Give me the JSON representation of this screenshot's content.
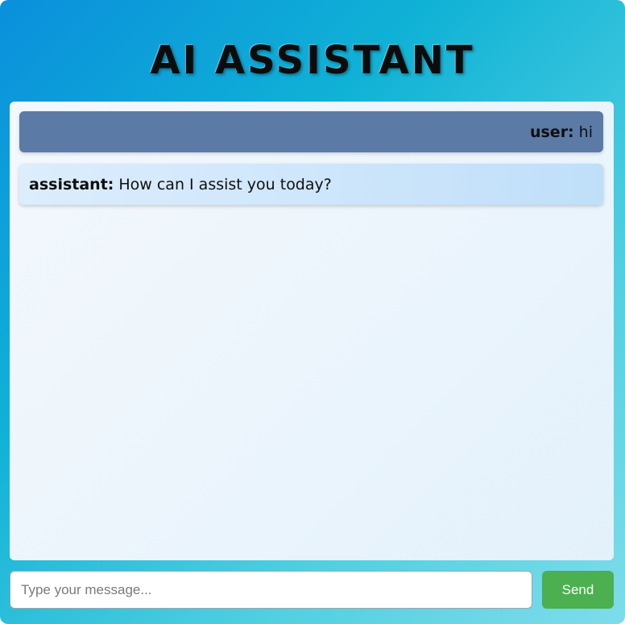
{
  "header": {
    "title": "AI ASSISTANT"
  },
  "messages": [
    {
      "role_label": "user:",
      "text": "hi"
    },
    {
      "role_label": "assistant:",
      "text": "How can I assist you today?"
    }
  ],
  "composer": {
    "placeholder": "Type your message...",
    "value": "",
    "send_label": "Send"
  },
  "colors": {
    "user_bubble": "#5b7aa6",
    "assistant_bubble": "#cfe6fb",
    "send_button": "#4caf50"
  }
}
